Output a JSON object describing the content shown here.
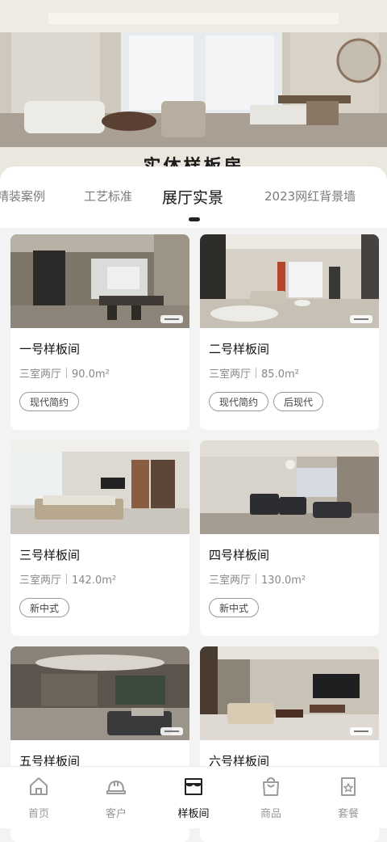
{
  "banner": {
    "title": "实体样板房"
  },
  "tabs": [
    {
      "label": "精装案例"
    },
    {
      "label": "工艺标准"
    },
    {
      "label": "展厅实景"
    },
    {
      "label": "2023网红背景墙"
    }
  ],
  "active_tab": "展厅实景",
  "cards": [
    {
      "title": "一号样板间",
      "layout": "三室两厅",
      "area": "90.0m²",
      "tags": [
        "现代简约"
      ]
    },
    {
      "title": "二号样板间",
      "layout": "三室两厅",
      "area": "85.0m²",
      "tags": [
        "现代简约",
        "后现代"
      ]
    },
    {
      "title": "三号样板间",
      "layout": "三室两厅",
      "area": "142.0m²",
      "tags": [
        "新中式"
      ]
    },
    {
      "title": "四号样板间",
      "layout": "三室两厅",
      "area": "130.0m²",
      "tags": [
        "新中式"
      ]
    },
    {
      "title": "五号样板间"
    },
    {
      "title": "六号样板间"
    }
  ],
  "bottom_nav": [
    {
      "label": "首页",
      "icon": "home-icon"
    },
    {
      "label": "客户",
      "icon": "hardhat-icon"
    },
    {
      "label": "样板间",
      "icon": "storefront-icon",
      "active": true
    },
    {
      "label": "商品",
      "icon": "shopping-bag-icon"
    },
    {
      "label": "套餐",
      "icon": "package-icon"
    }
  ]
}
